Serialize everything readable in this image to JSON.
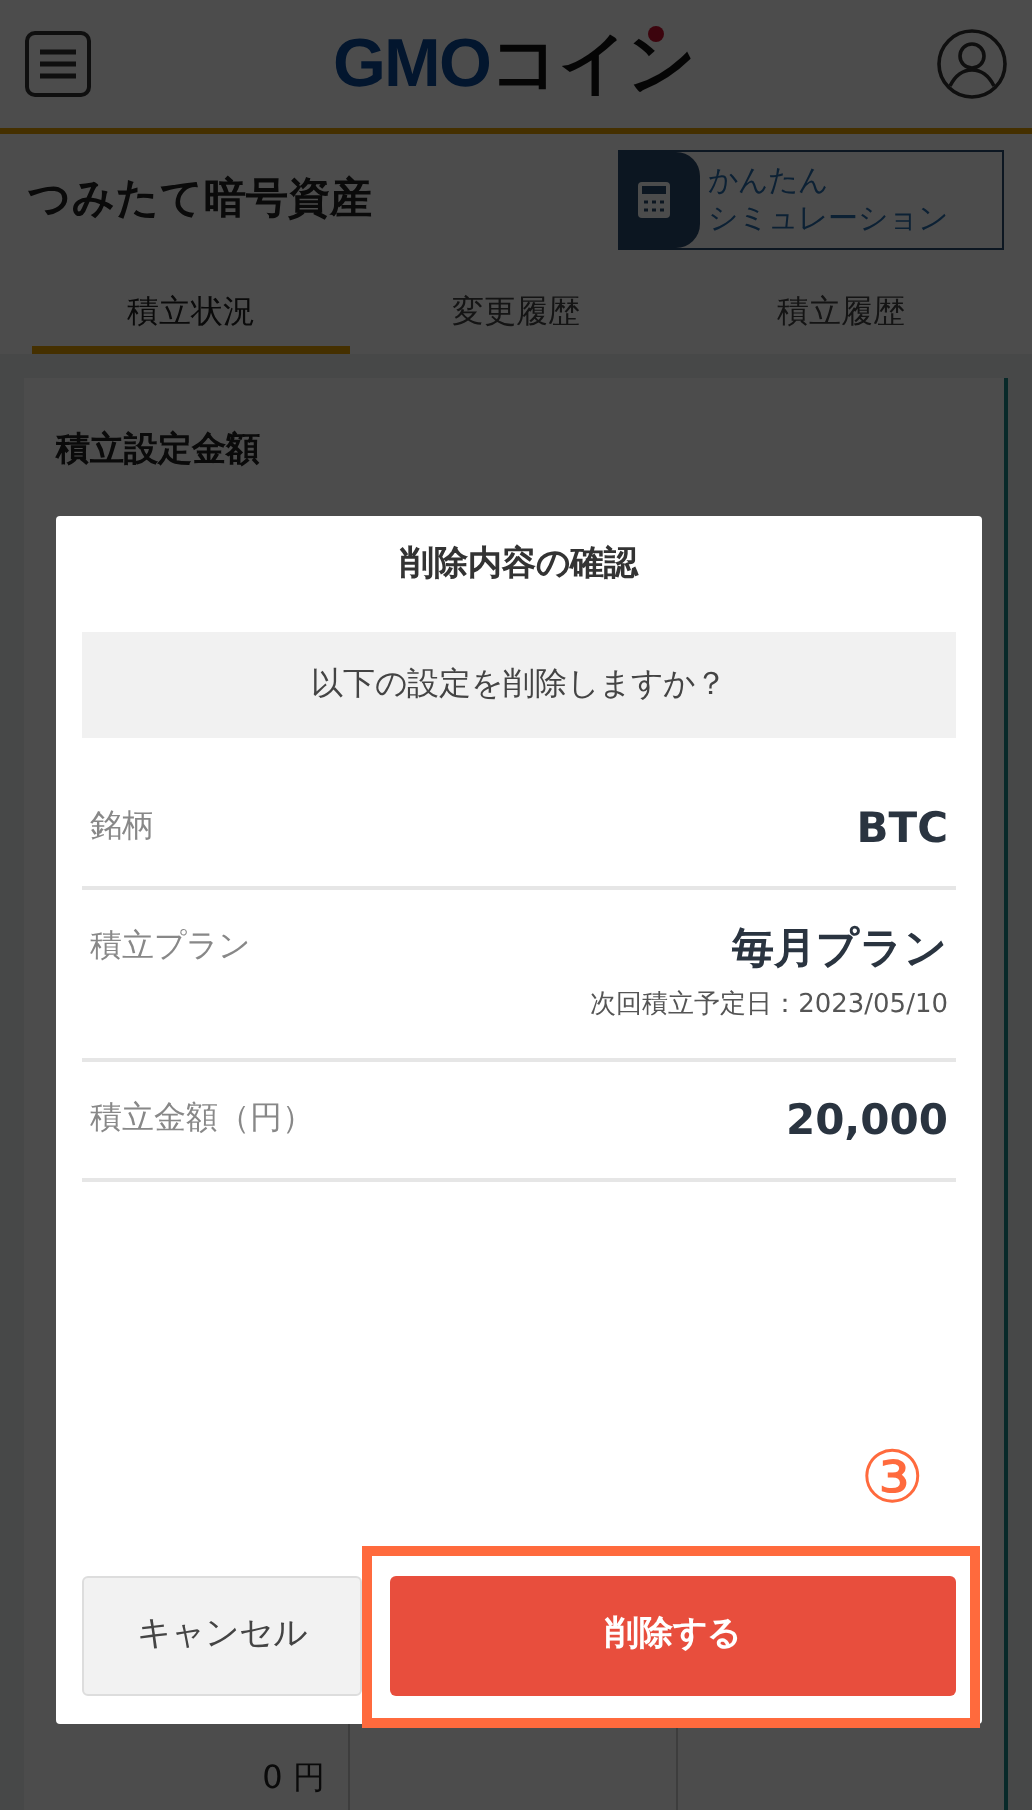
{
  "header": {
    "logo": {
      "latin": "GMO",
      "kana": "コイン"
    }
  },
  "page_title": "つみたて暗号資産",
  "simulation_button": {
    "line_1": "かんたん",
    "line_2": "シミュレーション"
  },
  "tabs": [
    {
      "label": "積立状況",
      "selected": true
    },
    {
      "label": "変更履歴",
      "selected": false
    },
    {
      "label": "積立履歴",
      "selected": false
    }
  ],
  "card": {
    "title": "積立設定金額",
    "amount": "0 円"
  },
  "dialog": {
    "title": "削除内容の確認",
    "message": "以下の設定を削除しますか？",
    "rows": [
      {
        "label": "銘柄",
        "value": "BTC"
      },
      {
        "label": "積立プラン",
        "value": "毎月プラン",
        "note": "次回積立予定日：2023/05/10"
      },
      {
        "label": "積立金額（円）",
        "value": "20,000"
      }
    ],
    "buttons": [
      {
        "label": "キャンセル",
        "kind": "secondary",
        "highlighted": false
      },
      {
        "label": "削除する",
        "kind": "danger",
        "highlighted": true
      }
    ]
  },
  "annotation": {
    "label": "③"
  }
}
